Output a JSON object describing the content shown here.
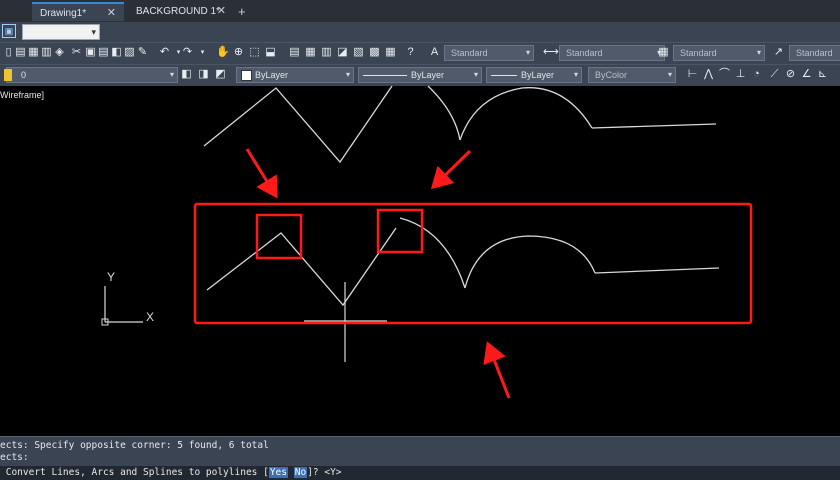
{
  "tabs": [
    {
      "label": "Drawing1*",
      "active": true
    },
    {
      "label": "BACKGROUND 1*",
      "active": false
    }
  ],
  "toolbar": {
    "text_style": "Standard",
    "dim_style": "Standard",
    "table_style": "Standard",
    "multileader_style": "Standard"
  },
  "properties": {
    "layer": "0",
    "color": "ByLayer",
    "linetype": "ByLayer",
    "lineweight": "ByLayer",
    "plotstyle": "ByColor"
  },
  "viewport": {
    "visual_style": "Wireframe]"
  },
  "ucs": {
    "x_label": "X",
    "y_label": "Y"
  },
  "command": {
    "history_1": "ects: Specify opposite corner: 5 found, 6 total",
    "history_2": "ects:",
    "prompt_prefix": " Convert Lines, Arcs and Splines to polylines [",
    "option_yes": "Yes",
    "option_no": "No",
    "prompt_suffix": "]? <Y>"
  },
  "colors": {
    "annotation": "#ff1a1a",
    "geometry": "#d9d9d9",
    "ribbon": "#3b4453"
  }
}
